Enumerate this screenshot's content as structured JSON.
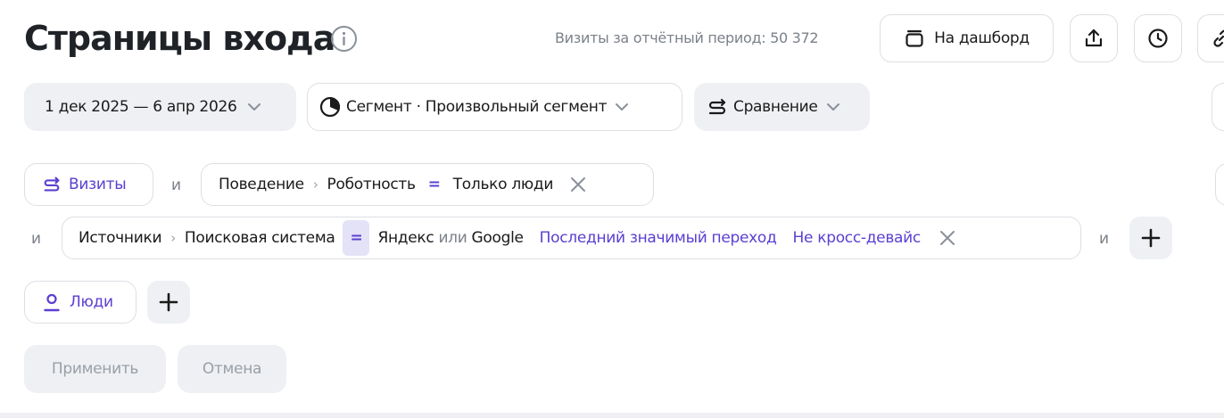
{
  "header": {
    "title": "Страницы входа",
    "visits_label": "Визиты за отчётный период: 50 372",
    "dashboard_label": "На дашборд"
  },
  "filters": {
    "date_range": "1 дек 2025 — 6 апр 2026",
    "segment_label": "Сегмент · Произвольный сегмент",
    "compare_label": "Сравнение"
  },
  "conditions": {
    "visits_chip": "Визиты",
    "and": "и",
    "behavior": "Поведение",
    "robotness": "Роботность",
    "eq": "=",
    "only_people": "Только люди",
    "sources": "Источники",
    "search_engine": "Поисковая система",
    "yandex": "Яндекс",
    "or": "или",
    "google": "Google",
    "last_significant": "Последний значимый переход",
    "not_cross_device": "Не кросс-девайс",
    "people_chip": "Люди"
  },
  "actions": {
    "apply": "Применить",
    "cancel": "Отмена"
  },
  "colors": {
    "accent": "#5b3fd1",
    "muted": "#7b8189",
    "chip_bg": "#eef0f3"
  },
  "icons": [
    "info-icon",
    "dashboard-icon",
    "share-icon",
    "clock-icon",
    "link-icon",
    "chevron-down-icon",
    "pie-chart-icon",
    "compare-icon",
    "close-icon",
    "plus-icon",
    "person-icon"
  ]
}
